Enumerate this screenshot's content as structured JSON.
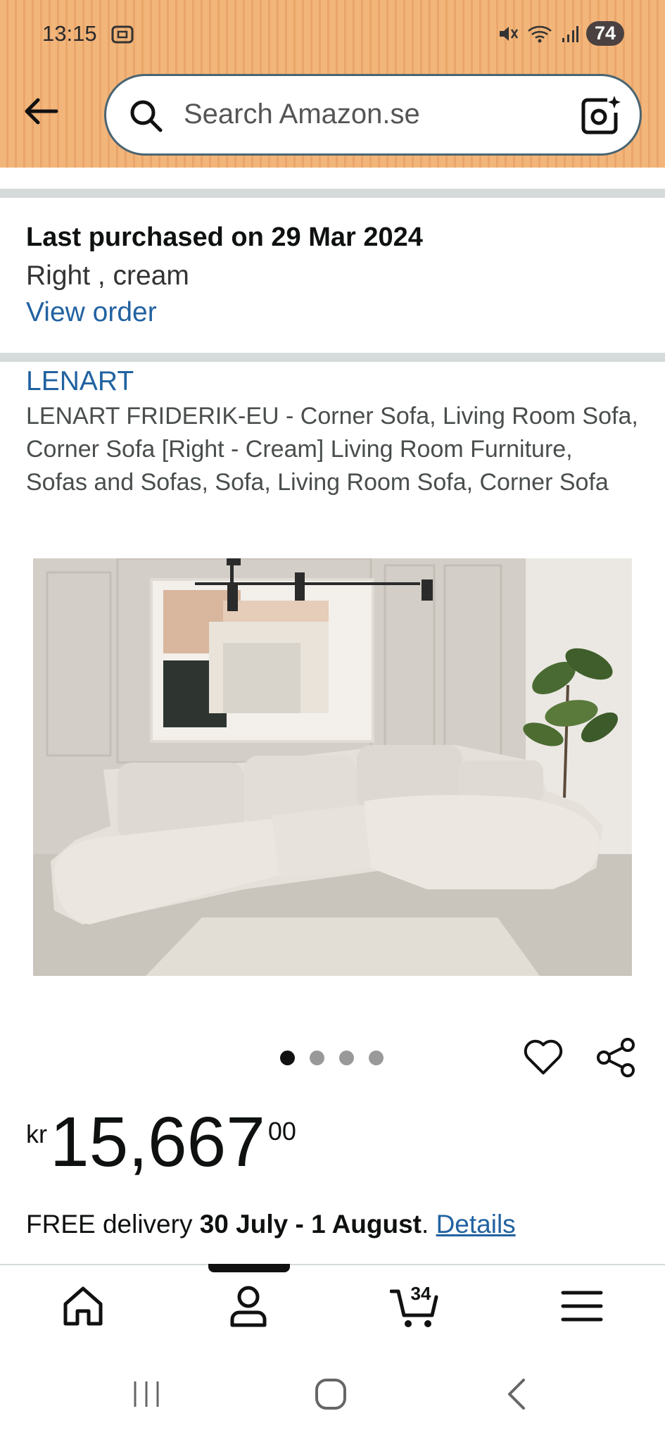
{
  "status_bar": {
    "time": "13:15",
    "battery": "74"
  },
  "search": {
    "placeholder": "Search Amazon.se"
  },
  "purchase": {
    "last_purchased": "Last purchased on 29 Mar 2024",
    "variant": "Right , cream",
    "view_order": "View order"
  },
  "product": {
    "brand": "LENART",
    "title": "LENART FRIDERIK-EU - Corner Sofa, Living Room Sofa, Corner Sofa [Right - Cream] Living Room Furniture, Sofas and Sofas, Sofa, Living Room Sofa, Corner Sofa",
    "image_count": 4,
    "active_image": 1
  },
  "price": {
    "currency": "kr",
    "whole": "15,667",
    "fraction": "00"
  },
  "delivery": {
    "prefix": "FREE delivery ",
    "dates": "30 July - 1 August",
    "suffix": ". ",
    "details": "Details"
  },
  "bottom_nav": {
    "cart_count": "34"
  },
  "colors": {
    "header": "#f2b57a",
    "link": "#2162a1",
    "separator": "#d5dbdb"
  }
}
